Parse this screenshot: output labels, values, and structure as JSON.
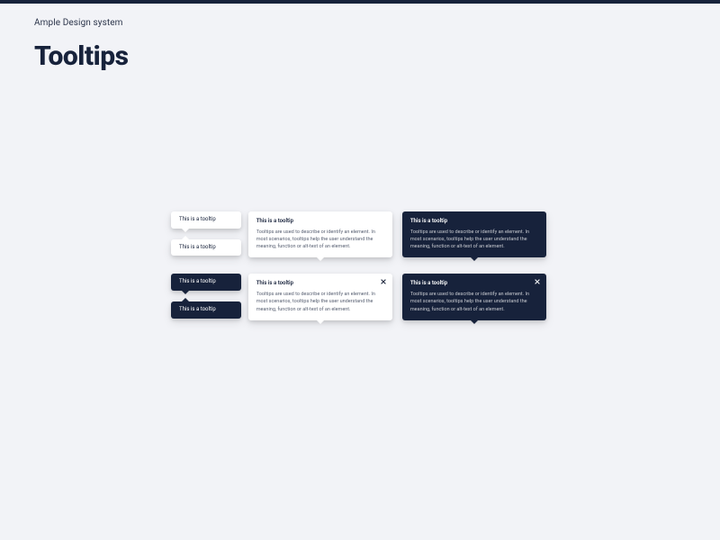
{
  "header": {
    "breadcrumb": "Ample Design system",
    "title": "Tooltips"
  },
  "tooltip": {
    "simple_text": "This is a tooltip",
    "rich_title": "This is a tooltip",
    "rich_body": "Tooltips are used to describe or identify an element. In most scenarios, tooltips help the user understand the meaning, function or alt-text of an element."
  },
  "colors": {
    "dark": "#17223b",
    "light": "#ffffff",
    "page_bg": "#f2f3f7"
  }
}
